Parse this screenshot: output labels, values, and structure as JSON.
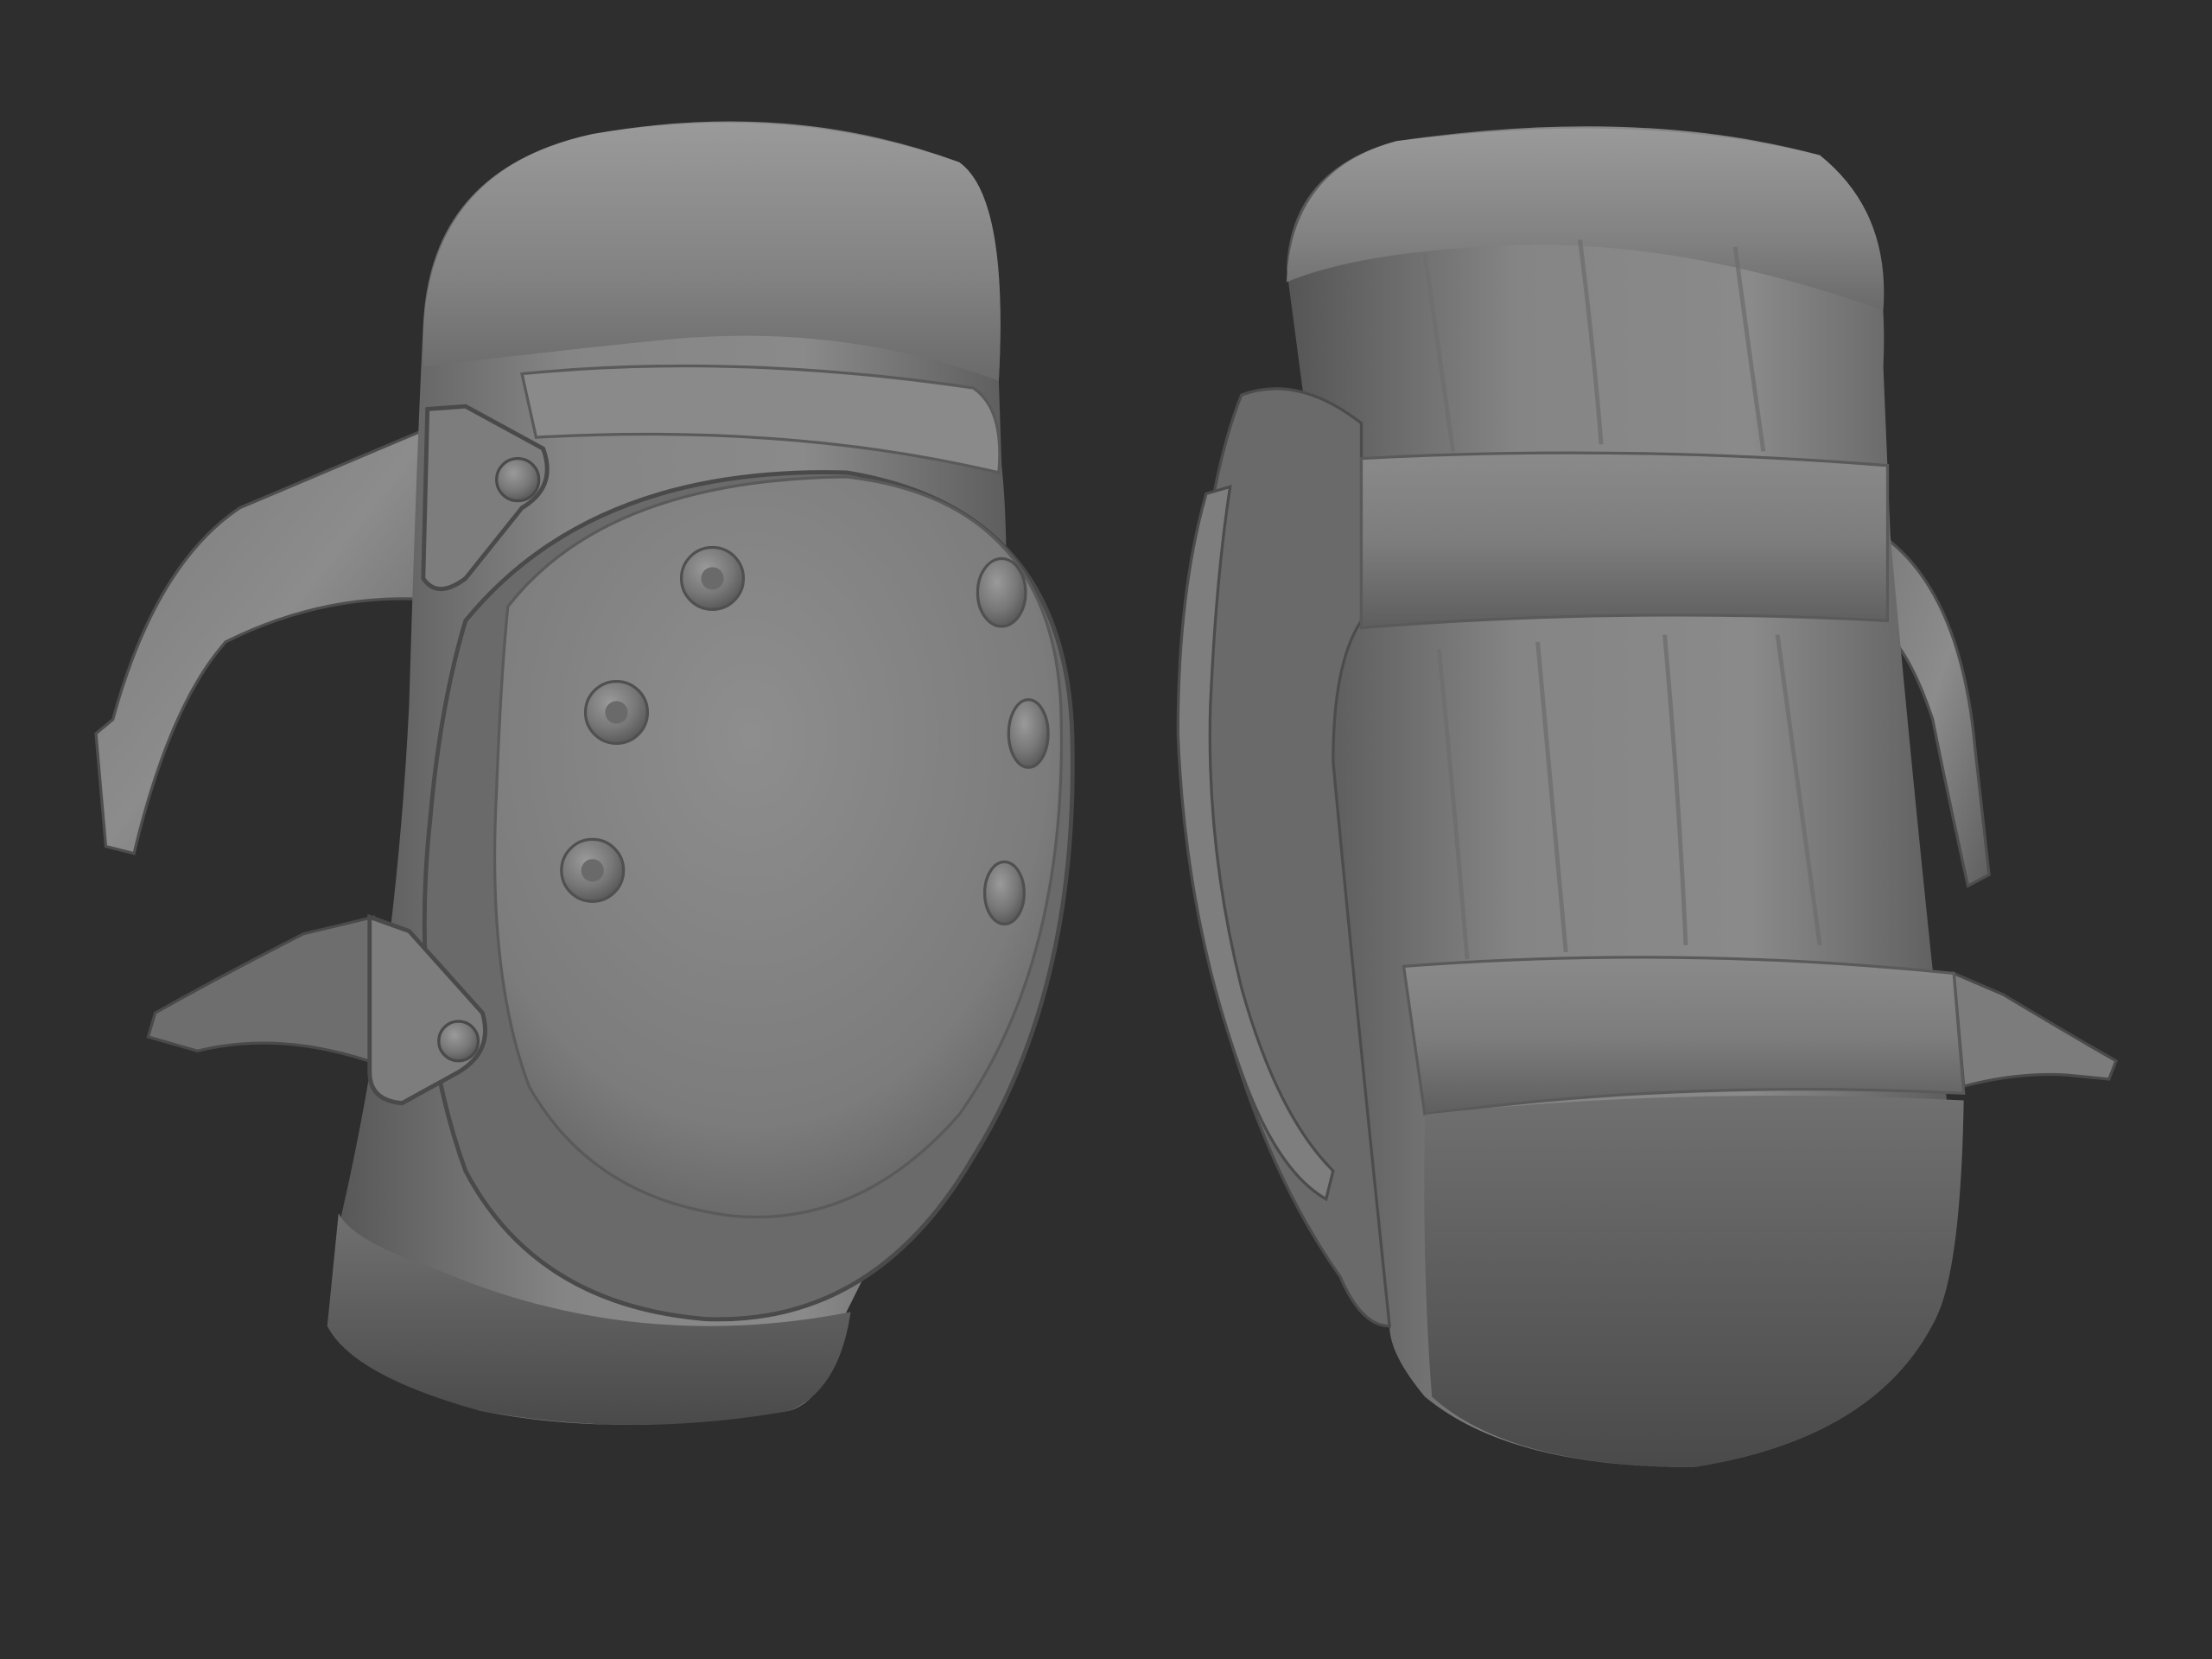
{
  "scene": {
    "background_color": "#2e2e2e",
    "material_colors": {
      "light": "#8f8f8f",
      "mid": "#767676",
      "dark": "#555555",
      "shadow": "#3a3a3a",
      "highlight": "#a8a8a8"
    },
    "objects": [
      {
        "name": "knee-pad-front-view"
      },
      {
        "name": "knee-pad-back-view"
      }
    ]
  }
}
